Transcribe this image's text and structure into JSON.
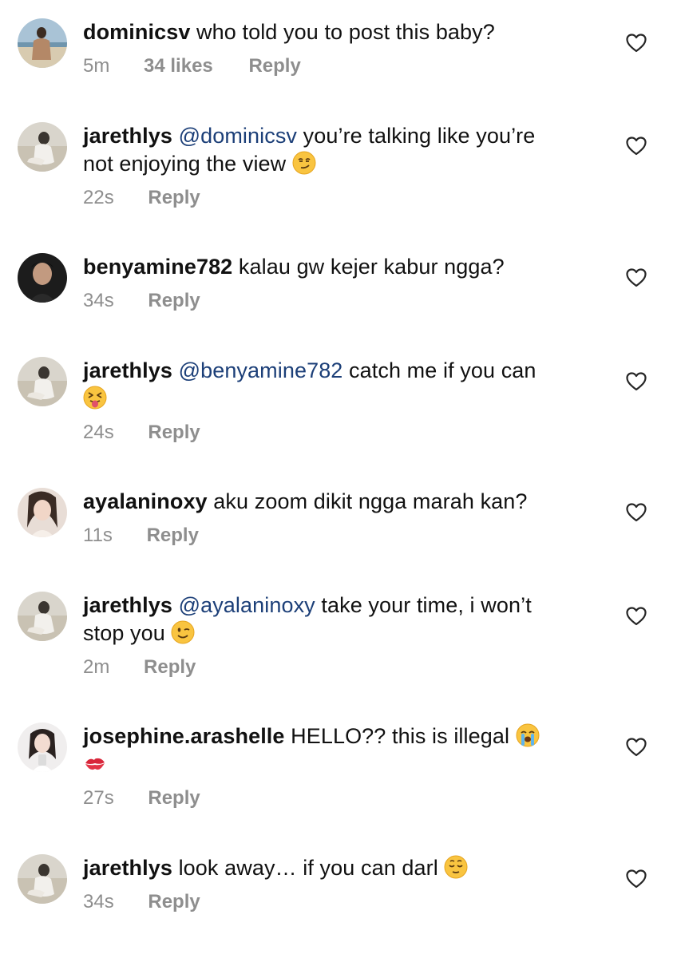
{
  "comments": [
    {
      "username": "dominicsv",
      "mention": "",
      "text": "who told you to post this baby?",
      "text_lines": [
        "who told you to post this baby?"
      ],
      "time": "5m",
      "likes": "34 likes",
      "reply": "Reply",
      "avatar": "beach-photo-avatar"
    },
    {
      "username": "jarethlys",
      "mention": "@dominicsv",
      "text": "you’re talking like you’re not enjoying the view",
      "text_lines": [
        "you’re talking like you’re",
        "not enjoying the view"
      ],
      "emoji": "smirking-face-emoji",
      "time": "22s",
      "reply": "Reply",
      "avatar": "sitting-person-avatar"
    },
    {
      "username": "benyamine782",
      "mention": "",
      "text": "kalau gw kejer kabur ngga?",
      "text_lines": [
        "kalau gw kejer kabur ngga?"
      ],
      "time": "34s",
      "reply": "Reply",
      "avatar": "dark-portrait-avatar"
    },
    {
      "username": "jarethlys",
      "mention": "@benyamine782",
      "text": "catch me if you can",
      "text_lines": [
        "catch me if you can"
      ],
      "emoji": "squinting-face-with-tongue-emoji",
      "time": "24s",
      "reply": "Reply",
      "avatar": "sitting-person-avatar"
    },
    {
      "username": "ayalaninoxy",
      "mention": "",
      "text": "aku zoom dikit ngga marah kan?",
      "text_lines": [
        "aku zoom dikit ngga marah kan?"
      ],
      "time": "11s",
      "reply": "Reply",
      "avatar": "woman-portrait-avatar"
    },
    {
      "username": "jarethlys",
      "mention": "@ayalaninoxy",
      "text": "take your time, i won’t stop you",
      "text_lines": [
        "take your time, i won’t",
        "stop you"
      ],
      "emoji": "winking-face-emoji",
      "time": "2m",
      "reply": "Reply",
      "avatar": "sitting-person-avatar"
    },
    {
      "username": "josephine.arashelle",
      "mention": "",
      "text": "HELLO?? this is illegal",
      "text_lines": [
        "HELLO?? this is illegal"
      ],
      "emoji": "loudly-crying-face-emoji",
      "emoji2": "kiss-mark-emoji",
      "time": "27s",
      "reply": "Reply",
      "avatar": "girl-portrait-avatar"
    },
    {
      "username": "jarethlys",
      "mention": "",
      "text": "look away… if you can darl",
      "text_lines": [
        "look away… if you can darl"
      ],
      "emoji": "relieved-face-emoji",
      "time": "34s",
      "reply": "Reply",
      "avatar": "sitting-person-avatar"
    }
  ],
  "icons": {
    "like": "heart-outline-icon"
  },
  "colors": {
    "mention": "#1c3f78",
    "meta": "#8e8e8e",
    "heart_stroke": "#262626"
  }
}
